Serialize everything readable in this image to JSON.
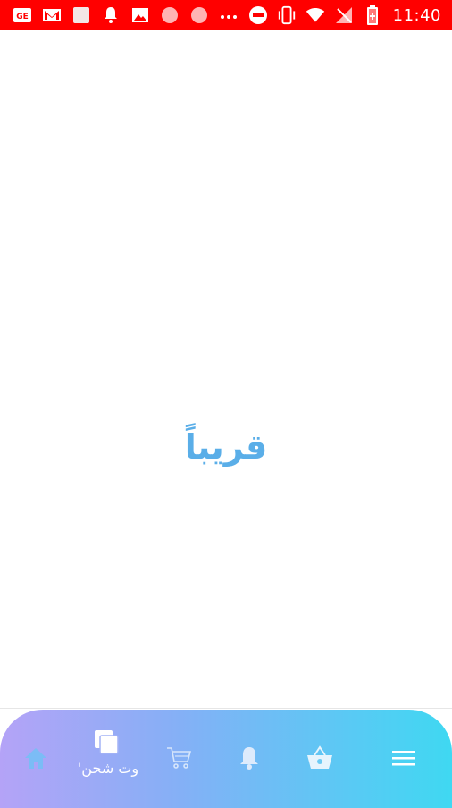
{
  "status_bar": {
    "time": "11:40",
    "left_icons": [
      "gmail-ge-icon",
      "gmail-icon",
      "square-icon",
      "bell-icon",
      "image-icon",
      "circle-icon",
      "circle-icon",
      "more-dots-icon"
    ],
    "right_icons": [
      "dnd-icon",
      "vibrate-icon",
      "wifi-icon",
      "no-signal-icon",
      "battery-charging-icon"
    ],
    "background": "#ff0000"
  },
  "main": {
    "message": "قريباً",
    "message_color": "#5aaee8"
  },
  "bottom_nav": {
    "items": [
      {
        "icon": "home-icon",
        "label": ""
      },
      {
        "icon": "cards-icon",
        "label": "بوت شحن"
      },
      {
        "icon": "cart-icon",
        "label": ""
      },
      {
        "icon": "bell-icon",
        "label": ""
      },
      {
        "icon": "basket-icon",
        "label": ""
      },
      {
        "icon": "menu-icon",
        "label": ""
      }
    ],
    "active_label_visible": "وت شحن'",
    "gradient_start": "#b4a3f7",
    "gradient_end": "#3fd8f2"
  }
}
